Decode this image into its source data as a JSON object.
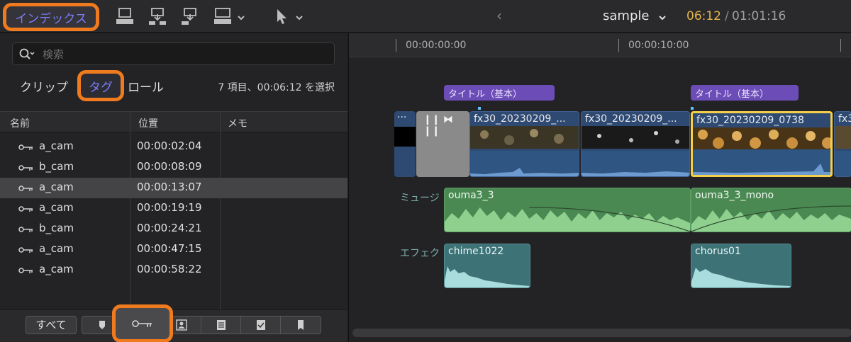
{
  "toolbar": {
    "index_label": "インデックス",
    "back_glyph": "‹",
    "project_name": "sample",
    "timecode_current": "06:12",
    "timecode_separator": "/",
    "timecode_duration": "01:01:16"
  },
  "index_panel": {
    "search_placeholder": "検索",
    "tabs": [
      {
        "label": "クリップ",
        "selected": false
      },
      {
        "label": "タグ",
        "selected": true
      },
      {
        "label": "ロール",
        "selected": false
      }
    ],
    "selection_info": "7 項目、00:06:12 を選択",
    "columns": [
      "名前",
      "位置",
      "メモ"
    ],
    "rows": [
      {
        "name": "a_cam",
        "position": "00:00:02:04",
        "memo": "",
        "selected": false
      },
      {
        "name": "b_cam",
        "position": "00:00:08:09",
        "memo": "",
        "selected": false
      },
      {
        "name": "a_cam",
        "position": "00:00:13:07",
        "memo": "",
        "selected": true
      },
      {
        "name": "a_cam",
        "position": "00:00:19:19",
        "memo": "",
        "selected": false
      },
      {
        "name": "b_cam",
        "position": "00:00:24:21",
        "memo": "",
        "selected": false
      },
      {
        "name": "a_cam",
        "position": "00:00:47:15",
        "memo": "",
        "selected": false
      },
      {
        "name": "a_cam",
        "position": "00:00:58:22",
        "memo": "",
        "selected": false
      }
    ],
    "filter_all_label": "すべて"
  },
  "timeline": {
    "ruler_labels": [
      "00:00:00:00",
      "00:00:10:00"
    ],
    "lanes": {
      "music": "ミュージ",
      "effects": "エフェク"
    },
    "titles": [
      {
        "label": "タイトル（基本）"
      },
      {
        "label": "タイトル（基本）"
      }
    ],
    "video_clips": [
      {
        "name": "fx30_20230209_..."
      },
      {
        "name": "fx30_20230209_..."
      },
      {
        "name": "fx30_20230209_0738",
        "selected": true
      },
      {
        "name": "fx3"
      }
    ],
    "lead_clip_label": "···",
    "gap_clip_label": "❙❙ ⧓ ❙❙",
    "music_clips": [
      {
        "name": "ouma3_3"
      },
      {
        "name": "ouma3_3_mono"
      }
    ],
    "effect_clips": [
      {
        "name": "chime1022"
      },
      {
        "name": "chorus01"
      }
    ]
  },
  "colors": {
    "accent_orange": "#f07a1e",
    "active_blue": "#7b7cf5",
    "timecode_yellow": "#e2b34a",
    "title_purple": "#6c4cb6",
    "video_blue": "#2e4a73",
    "music_green": "#4a8a52",
    "effects_teal": "#3d7377",
    "selection_yellow": "#f4d04a"
  }
}
